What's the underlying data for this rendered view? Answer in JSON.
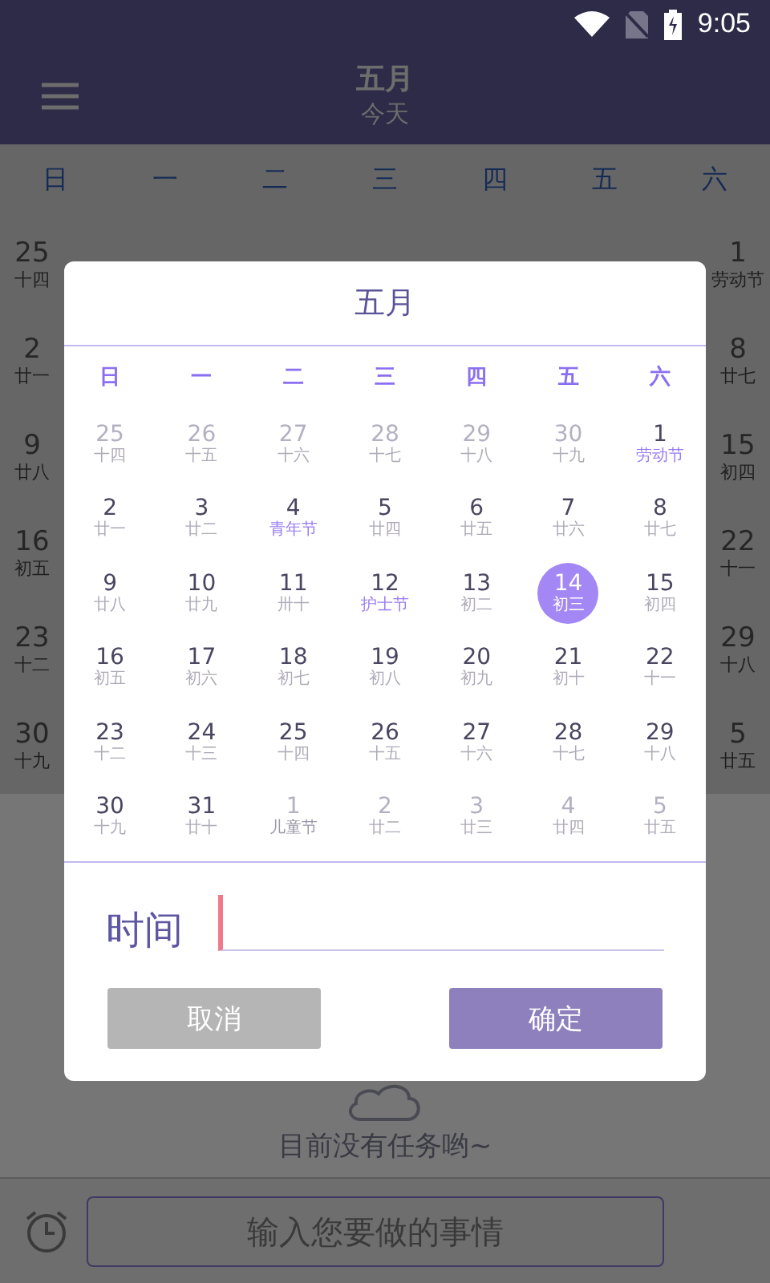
{
  "status_bar": {
    "time": "9:05"
  },
  "header": {
    "title": "五月",
    "subtitle": "今天"
  },
  "background_calendar": {
    "weekdays": [
      "日",
      "一",
      "二",
      "三",
      "四",
      "五",
      "六"
    ],
    "left_column": [
      {
        "day": "25",
        "lunar": "十四"
      },
      {
        "day": "2",
        "lunar": "廿一"
      },
      {
        "day": "9",
        "lunar": "廿八"
      },
      {
        "day": "16",
        "lunar": "初五"
      },
      {
        "day": "23",
        "lunar": "十二"
      },
      {
        "day": "30",
        "lunar": "十九"
      }
    ],
    "right_column": [
      {
        "day": "1",
        "lunar": "劳动节"
      },
      {
        "day": "8",
        "lunar": "廿七"
      },
      {
        "day": "15",
        "lunar": "初四"
      },
      {
        "day": "22",
        "lunar": "十一"
      },
      {
        "day": "29",
        "lunar": "十八"
      },
      {
        "day": "5",
        "lunar": "廿五"
      }
    ]
  },
  "empty_message": "目前没有任务哟~",
  "task_input": {
    "placeholder": "输入您要做的事情"
  },
  "dialog": {
    "title": "五月",
    "weekdays": [
      "日",
      "一",
      "二",
      "三",
      "四",
      "五",
      "六"
    ],
    "days": [
      {
        "day": "25",
        "lunar": "十四",
        "other_month": true,
        "festival": false,
        "selected": false
      },
      {
        "day": "26",
        "lunar": "十五",
        "other_month": true,
        "festival": false,
        "selected": false
      },
      {
        "day": "27",
        "lunar": "十六",
        "other_month": true,
        "festival": false,
        "selected": false
      },
      {
        "day": "28",
        "lunar": "十七",
        "other_month": true,
        "festival": false,
        "selected": false
      },
      {
        "day": "29",
        "lunar": "十八",
        "other_month": true,
        "festival": false,
        "selected": false
      },
      {
        "day": "30",
        "lunar": "十九",
        "other_month": true,
        "festival": false,
        "selected": false
      },
      {
        "day": "1",
        "lunar": "劳动节",
        "other_month": false,
        "festival": true,
        "selected": false
      },
      {
        "day": "2",
        "lunar": "廿一",
        "other_month": false,
        "festival": false,
        "selected": false
      },
      {
        "day": "3",
        "lunar": "廿二",
        "other_month": false,
        "festival": false,
        "selected": false
      },
      {
        "day": "4",
        "lunar": "青年节",
        "other_month": false,
        "festival": true,
        "selected": false
      },
      {
        "day": "5",
        "lunar": "廿四",
        "other_month": false,
        "festival": false,
        "selected": false
      },
      {
        "day": "6",
        "lunar": "廿五",
        "other_month": false,
        "festival": false,
        "selected": false
      },
      {
        "day": "7",
        "lunar": "廿六",
        "other_month": false,
        "festival": false,
        "selected": false
      },
      {
        "day": "8",
        "lunar": "廿七",
        "other_month": false,
        "festival": false,
        "selected": false
      },
      {
        "day": "9",
        "lunar": "廿八",
        "other_month": false,
        "festival": false,
        "selected": false
      },
      {
        "day": "10",
        "lunar": "廿九",
        "other_month": false,
        "festival": false,
        "selected": false
      },
      {
        "day": "11",
        "lunar": "卅十",
        "other_month": false,
        "festival": false,
        "selected": false
      },
      {
        "day": "12",
        "lunar": "护士节",
        "other_month": false,
        "festival": true,
        "selected": false
      },
      {
        "day": "13",
        "lunar": "初二",
        "other_month": false,
        "festival": false,
        "selected": false
      },
      {
        "day": "14",
        "lunar": "初三",
        "other_month": false,
        "festival": false,
        "selected": true
      },
      {
        "day": "15",
        "lunar": "初四",
        "other_month": false,
        "festival": false,
        "selected": false
      },
      {
        "day": "16",
        "lunar": "初五",
        "other_month": false,
        "festival": false,
        "selected": false
      },
      {
        "day": "17",
        "lunar": "初六",
        "other_month": false,
        "festival": false,
        "selected": false
      },
      {
        "day": "18",
        "lunar": "初七",
        "other_month": false,
        "festival": false,
        "selected": false
      },
      {
        "day": "19",
        "lunar": "初八",
        "other_month": false,
        "festival": false,
        "selected": false
      },
      {
        "day": "20",
        "lunar": "初九",
        "other_month": false,
        "festival": false,
        "selected": false
      },
      {
        "day": "21",
        "lunar": "初十",
        "other_month": false,
        "festival": false,
        "selected": false
      },
      {
        "day": "22",
        "lunar": "十一",
        "other_month": false,
        "festival": false,
        "selected": false
      },
      {
        "day": "23",
        "lunar": "十二",
        "other_month": false,
        "festival": false,
        "selected": false
      },
      {
        "day": "24",
        "lunar": "十三",
        "other_month": false,
        "festival": false,
        "selected": false
      },
      {
        "day": "25",
        "lunar": "十四",
        "other_month": false,
        "festival": false,
        "selected": false
      },
      {
        "day": "26",
        "lunar": "十五",
        "other_month": false,
        "festival": false,
        "selected": false
      },
      {
        "day": "27",
        "lunar": "十六",
        "other_month": false,
        "festival": false,
        "selected": false
      },
      {
        "day": "28",
        "lunar": "十七",
        "other_month": false,
        "festival": false,
        "selected": false
      },
      {
        "day": "29",
        "lunar": "十八",
        "other_month": false,
        "festival": false,
        "selected": false
      },
      {
        "day": "30",
        "lunar": "十九",
        "other_month": false,
        "festival": false,
        "selected": false
      },
      {
        "day": "31",
        "lunar": "廿十",
        "other_month": false,
        "festival": false,
        "selected": false
      },
      {
        "day": "1",
        "lunar": "儿童节",
        "other_month": true,
        "festival": true,
        "selected": false
      },
      {
        "day": "2",
        "lunar": "廿二",
        "other_month": true,
        "festival": false,
        "selected": false
      },
      {
        "day": "3",
        "lunar": "廿三",
        "other_month": true,
        "festival": false,
        "selected": false
      },
      {
        "day": "4",
        "lunar": "廿四",
        "other_month": true,
        "festival": false,
        "selected": false
      },
      {
        "day": "5",
        "lunar": "廿五",
        "other_month": true,
        "festival": false,
        "selected": false
      }
    ],
    "time_label": "时间",
    "buttons": {
      "cancel": "取消",
      "confirm": "确定"
    }
  }
}
